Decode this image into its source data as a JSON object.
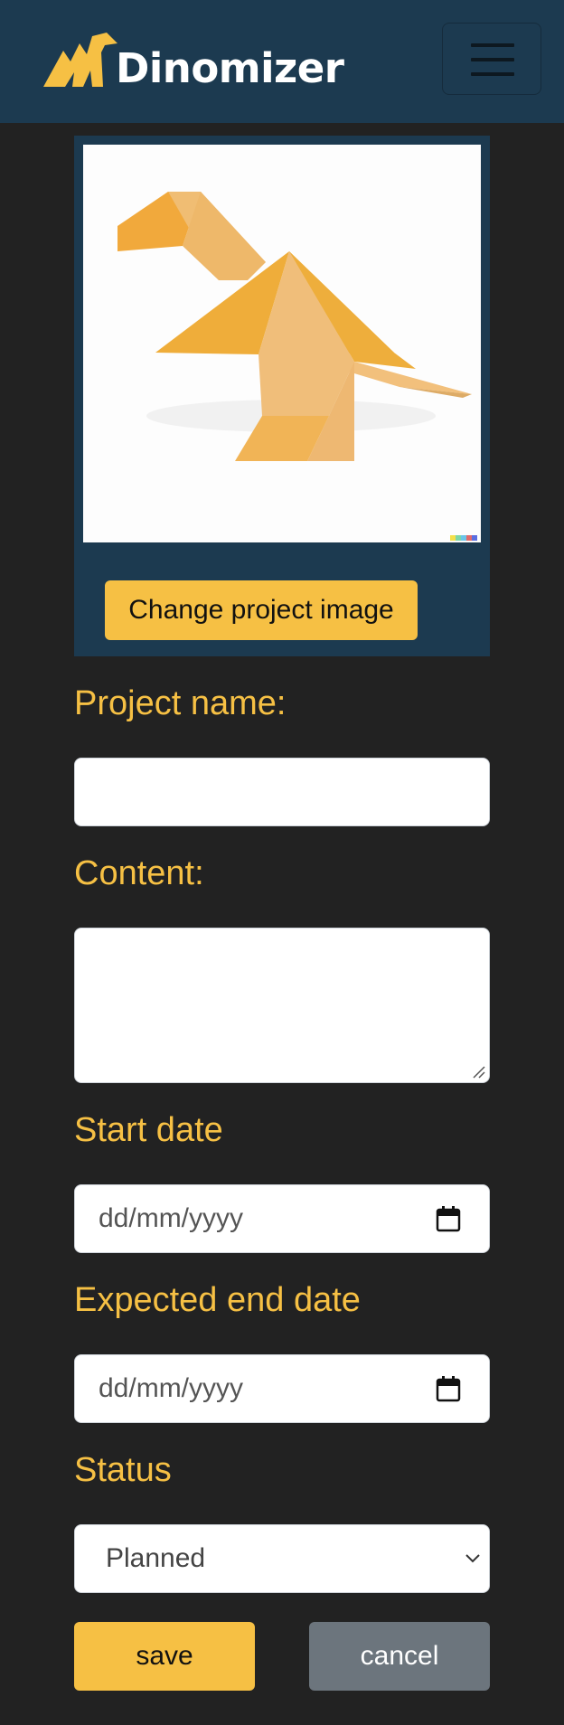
{
  "app": {
    "brand_name": "Dinomizer"
  },
  "image_card": {
    "change_button_label": "Change project image"
  },
  "form": {
    "project_name": {
      "label": "Project name:",
      "value": "",
      "placeholder": ""
    },
    "content": {
      "label": "Content:",
      "value": ""
    },
    "start_date": {
      "label": "Start date",
      "value": "dd/mm/yyyy"
    },
    "end_date": {
      "label": "Expected end date",
      "value": "dd/mm/yyyy"
    },
    "status": {
      "label": "Status",
      "value": "Planned"
    }
  },
  "actions": {
    "save_label": "save",
    "cancel_label": "cancel"
  },
  "colors": {
    "navbar": "#1c3a50",
    "background": "#222222",
    "accent": "#f6c044",
    "secondary": "#6c757d"
  },
  "icons": {
    "logo": "dinosaur-logo-icon",
    "menu": "hamburger-menu-icon",
    "calendar": "calendar-icon",
    "dropdown": "chevron-down-icon"
  }
}
